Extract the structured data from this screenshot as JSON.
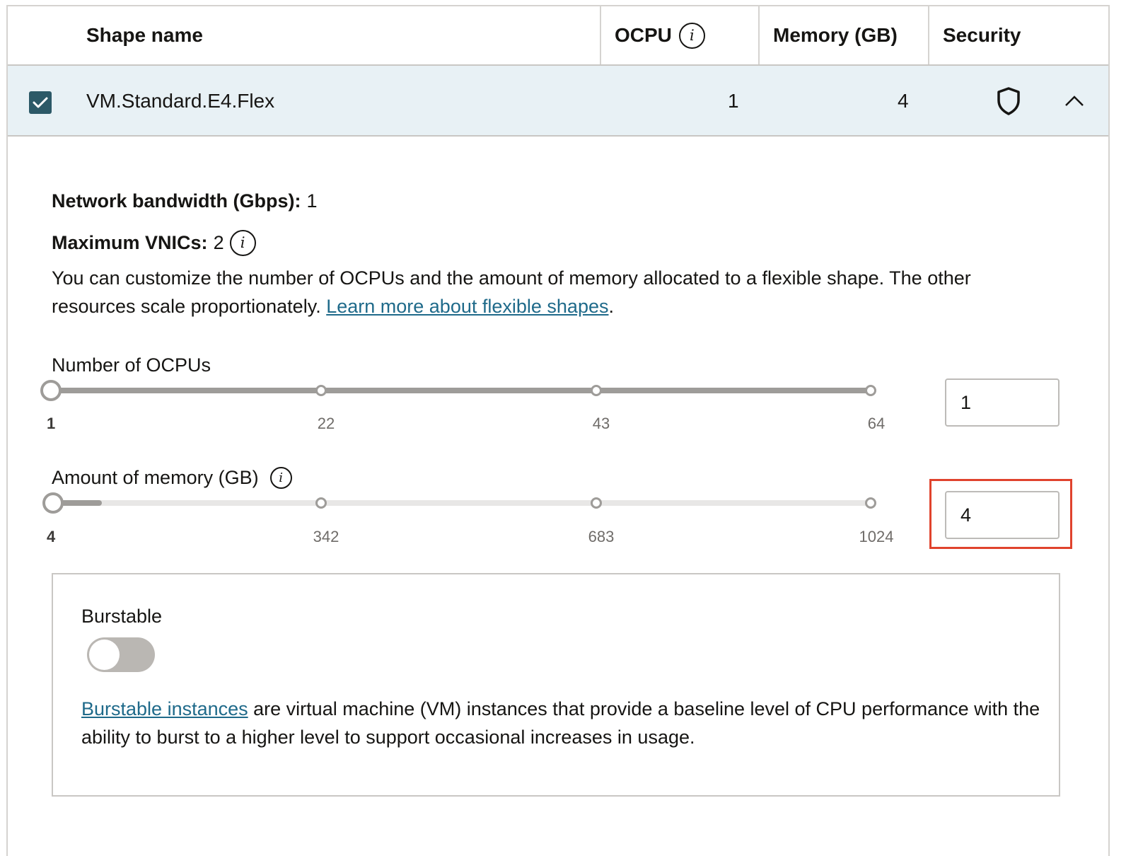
{
  "table": {
    "headers": {
      "shape_name": "Shape name",
      "ocpu": "OCPU",
      "memory": "Memory (GB)",
      "security": "Security"
    },
    "selected_row": {
      "checked": true,
      "shape_name": "VM.Standard.E4.Flex",
      "ocpu": "1",
      "memory": "4"
    }
  },
  "details": {
    "network_bandwidth_label": "Network bandwidth (Gbps):",
    "network_bandwidth_value": "1",
    "max_vnics_label": "Maximum VNICs:",
    "max_vnics_value": "2",
    "description": "You can customize the number of OCPUs and the amount of memory allocated to a flexible shape. The other resources scale proportionately.",
    "learn_more_link": "Learn more about flexible shapes",
    "description_end": "."
  },
  "ocpu_slider": {
    "label": "Number of OCPUs",
    "ticks": [
      "1",
      "22",
      "43",
      "64"
    ],
    "value": "1",
    "min": 1,
    "max": 64
  },
  "memory_slider": {
    "label": "Amount of memory (GB)",
    "ticks": [
      "4",
      "342",
      "683",
      "1024"
    ],
    "value": "4",
    "min": 1,
    "max": 1024
  },
  "burstable": {
    "title": "Burstable",
    "enabled": false,
    "link": "Burstable instances",
    "description": "are virtual machine (VM) instances that provide a baseline level of CPU performance with the ability to burst to a higher level to support occasional increases in usage."
  },
  "colors": {
    "row_selected_bg": "#e8f1f5",
    "checkbox": "#2c5967",
    "link": "#1f6a8a",
    "highlight": "#e0432d",
    "toggle_off": "#bab7b3"
  }
}
